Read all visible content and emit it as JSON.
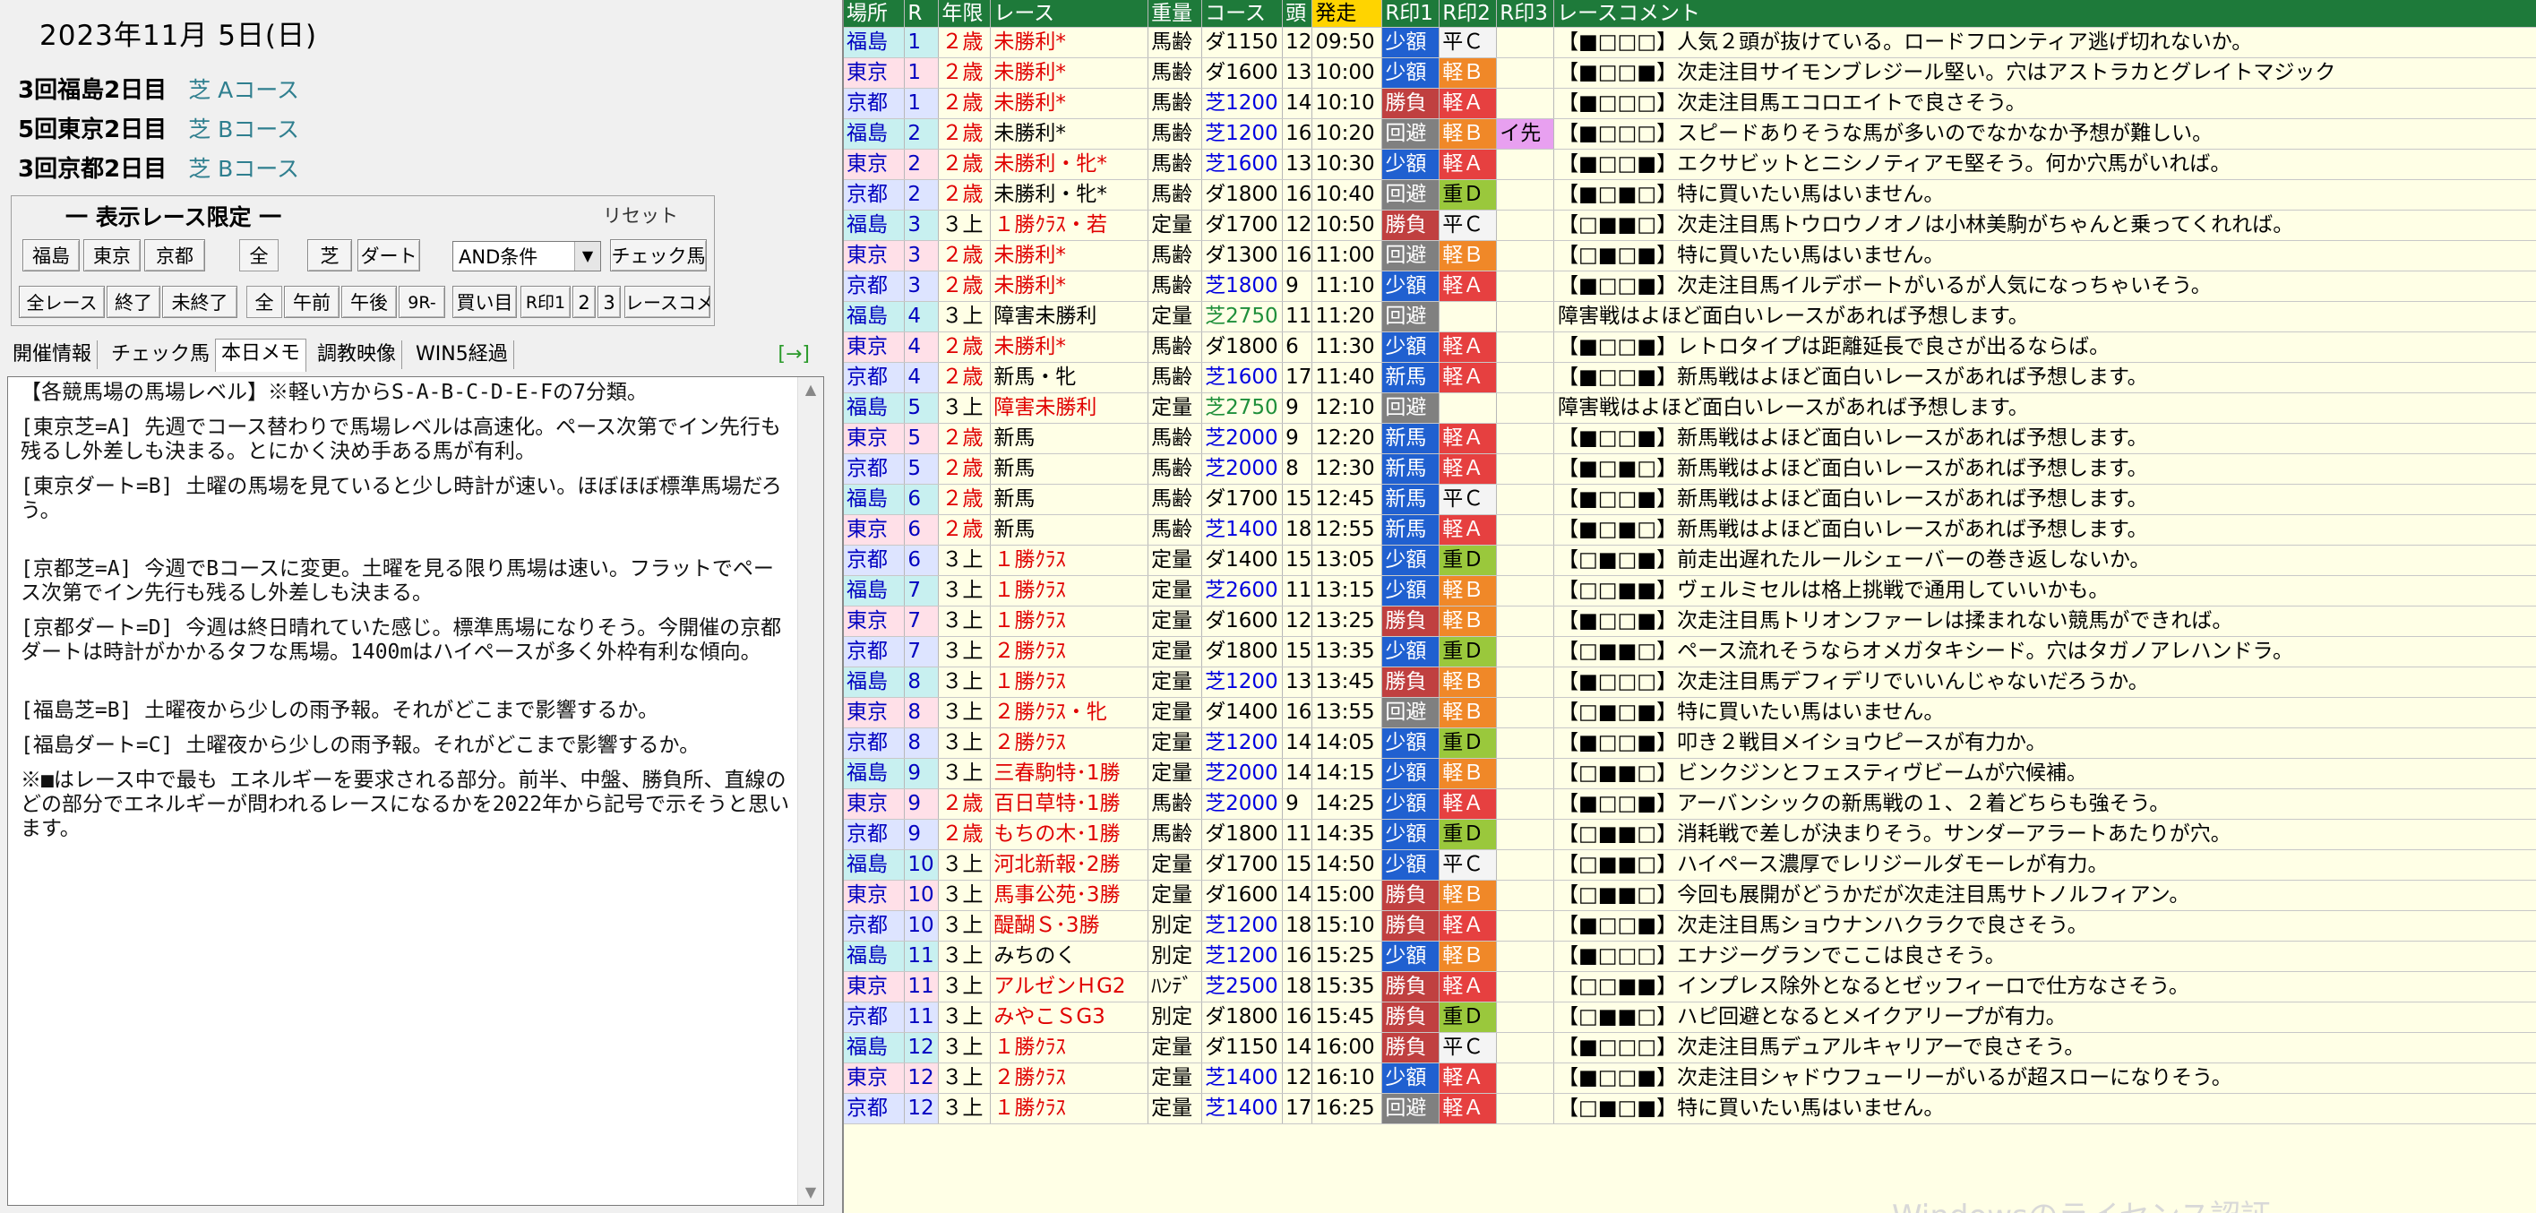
{
  "date": "2023年11月 5日(日)",
  "meetings": [
    {
      "name": "3回福島2日目",
      "course": "芝 Aコース"
    },
    {
      "name": "5回東京2日目",
      "course": "芝 Bコース"
    },
    {
      "name": "3回京都2日目",
      "course": "芝 Bコース"
    }
  ],
  "filter": {
    "title": "一 表示レース限定 一",
    "reset": "リセット",
    "row1": [
      "福島",
      "東京",
      "京都",
      "全",
      "芝",
      "ダート"
    ],
    "condition": "AND条件",
    "check_button": "チェック馬",
    "row2": [
      "全レース",
      "終了",
      "未終了",
      "全",
      "午前",
      "午後",
      "9R-",
      "買い目",
      "R印1",
      "2",
      "3",
      "レースコメ"
    ]
  },
  "tabs": [
    "開催情報",
    "チェック馬",
    "本日メモ",
    "調教映像",
    "WIN5経過"
  ],
  "tab_arrow": "[→]",
  "memo": [
    "【各競馬場の馬場レベル】※軽い方からS-A-B-C-D-E-Fの7分類。",
    "[東京芝=A] 先週でコース替わりで馬場レベルは高速化。ペース次第でイン先行も残るし外差しも決まる。とにかく決め手ある馬が有利。",
    "[東京ダート=B] 土曜の馬場を見ていると少し時計が速い。ほぼほぼ標準馬場だろう。",
    "[京都芝=A] 今週でBコースに変更。土曜を見る限り馬場は速い。フラットでペース次第でイン先行も残るし外差しも決まる。",
    "[京都ダート=D] 今週は終日晴れていた感じ。標準馬場になりそう。今開催の京都ダートは時計がかかるタフな馬場。1400mはハイペースが多く外枠有利な傾向。",
    "[福島芝=B] 土曜夜から少しの雨予報。それがどこまで影響するか。",
    "[福島ダート=C]  土曜夜から少しの雨予報。それがどこまで影響するか。",
    "※■はレース中で最も エネルギーを要求される部分。前半、中盤、勝負所、直線のどの部分でエネルギーが問われるレースになるかを2022年から記号で示そうと思います。"
  ],
  "table": {
    "headers": [
      "場所",
      "R",
      "年限",
      "レース",
      "重量",
      "コース",
      "頭",
      "発走",
      "R印1",
      "R印2",
      "R印3",
      "レースコメント"
    ],
    "rows": [
      [
        "福島",
        "1",
        "２歳",
        "未勝利*",
        "馬齢",
        "ダ1150",
        "12",
        "09:50",
        "少額",
        "平Ｃ",
        "",
        "【■□□□】人気２頭が抜けている。ロードフロンティア逃げ切れないか。"
      ],
      [
        "東京",
        "1",
        "２歳",
        "未勝利*",
        "馬齢",
        "ダ1600",
        "13",
        "10:00",
        "少額",
        "軽Ｂ",
        "",
        "【■□□■】次走注目サイモンブレジール堅い。穴はアストラカとグレイトマジック"
      ],
      [
        "京都",
        "1",
        "２歳",
        "未勝利*",
        "馬齢",
        "芝1200",
        "14",
        "10:10",
        "勝負",
        "軽Ａ",
        "",
        "【■□□□】次走注目馬エコロエイトで良さそう。"
      ],
      [
        "福島",
        "2",
        "２歳",
        "未勝利*",
        "馬齢",
        "芝1200",
        "16",
        "10:20",
        "回避",
        "軽Ｂ",
        "イ先",
        "【■□□□】スピードありそうな馬が多いのでなかなか予想が難しい。"
      ],
      [
        "東京",
        "2",
        "２歳",
        "未勝利・牝*",
        "馬齢",
        "芝1600",
        "13",
        "10:30",
        "少額",
        "軽Ａ",
        "",
        "【■□□■】エクサビットとニシノティアモ堅そう。何か穴馬がいれば。"
      ],
      [
        "京都",
        "2",
        "２歳",
        "未勝利・牝*",
        "馬齢",
        "ダ1800",
        "16",
        "10:40",
        "回避",
        "重Ｄ",
        "",
        "【■□■□】特に買いたい馬はいません。"
      ],
      [
        "福島",
        "3",
        "３上",
        "１勝ｸﾗｽ・若",
        "定量",
        "ダ1700",
        "12",
        "10:50",
        "勝負",
        "平Ｃ",
        "",
        "【□■■□】次走注目馬トウロウノオノは小林美駒がちゃんと乗ってくれれば。"
      ],
      [
        "東京",
        "3",
        "２歳",
        "未勝利*",
        "馬齢",
        "ダ1300",
        "16",
        "11:00",
        "回避",
        "軽Ｂ",
        "",
        "【□■□■】特に買いたい馬はいません。"
      ],
      [
        "京都",
        "3",
        "２歳",
        "未勝利*",
        "馬齢",
        "芝1800",
        "9",
        "11:10",
        "少額",
        "軽Ａ",
        "",
        "【■□□■】次走注目馬イルデボートがいるが人気になっちゃいそう。"
      ],
      [
        "福島",
        "4",
        "３上",
        "障害未勝利",
        "定量",
        "芝2750",
        "11",
        "11:20",
        "回避",
        "",
        "",
        "障害戦はよほど面白いレースがあれば予想します。"
      ],
      [
        "東京",
        "4",
        "２歳",
        "未勝利*",
        "馬齢",
        "ダ1800",
        "6",
        "11:30",
        "少額",
        "軽Ａ",
        "",
        "【■□□■】レトロタイプは距離延長で良さが出るならば。"
      ],
      [
        "京都",
        "4",
        "２歳",
        "新馬・牝",
        "馬齢",
        "芝1600",
        "17",
        "11:40",
        "新馬",
        "軽Ａ",
        "",
        "【■□□■】新馬戦はよほど面白いレースがあれば予想します。"
      ],
      [
        "福島",
        "5",
        "３上",
        "障害未勝利",
        "定量",
        "芝2750",
        "9",
        "12:10",
        "回避",
        "",
        "",
        "障害戦はよほど面白いレースがあれば予想します。"
      ],
      [
        "東京",
        "5",
        "２歳",
        "新馬",
        "馬齢",
        "芝2000",
        "9",
        "12:20",
        "新馬",
        "軽Ａ",
        "",
        "【■□□■】新馬戦はよほど面白いレースがあれば予想します。"
      ],
      [
        "京都",
        "5",
        "２歳",
        "新馬",
        "馬齢",
        "芝2000",
        "8",
        "12:30",
        "新馬",
        "軽Ａ",
        "",
        "【■□■□】新馬戦はよほど面白いレースがあれば予想します。"
      ],
      [
        "福島",
        "6",
        "２歳",
        "新馬",
        "馬齢",
        "ダ1700",
        "15",
        "12:45",
        "新馬",
        "平Ｃ",
        "",
        "【■□□■】新馬戦はよほど面白いレースがあれば予想します。"
      ],
      [
        "東京",
        "6",
        "２歳",
        "新馬",
        "馬齢",
        "芝1400",
        "18",
        "12:55",
        "新馬",
        "軽Ａ",
        "",
        "【■□■□】新馬戦はよほど面白いレースがあれば予想します。"
      ],
      [
        "京都",
        "6",
        "３上",
        "１勝ｸﾗｽ",
        "定量",
        "ダ1400",
        "15",
        "13:05",
        "少額",
        "重Ｄ",
        "",
        "【□■□■】前走出遅れたルールシェーバーの巻き返しないか。"
      ],
      [
        "福島",
        "7",
        "３上",
        "１勝ｸﾗｽ",
        "定量",
        "芝2600",
        "11",
        "13:15",
        "少額",
        "軽Ｂ",
        "",
        "【□□■■】ヴェルミセルは格上挑戦で通用していいかも。"
      ],
      [
        "東京",
        "7",
        "３上",
        "１勝ｸﾗｽ",
        "定量",
        "ダ1600",
        "12",
        "13:25",
        "勝負",
        "軽Ｂ",
        "",
        "【■□□■】次走注目馬トリオンファーレは揉まれない競馬ができれば。"
      ],
      [
        "京都",
        "7",
        "３上",
        "２勝ｸﾗｽ",
        "定量",
        "ダ1800",
        "15",
        "13:35",
        "少額",
        "重Ｄ",
        "",
        "【□■■□】ペース流れそうならオメガタキシード。穴はタガノアレハンドラ。"
      ],
      [
        "福島",
        "8",
        "３上",
        "１勝ｸﾗｽ",
        "定量",
        "芝1200",
        "13",
        "13:45",
        "勝負",
        "軽Ｂ",
        "",
        "【■□□□】次走注目馬デフィデリでいいんじゃないだろうか。"
      ],
      [
        "東京",
        "8",
        "３上",
        "２勝ｸﾗｽ・牝",
        "定量",
        "ダ1400",
        "16",
        "13:55",
        "回避",
        "軽Ｂ",
        "",
        "【□■□■】特に買いたい馬はいません。"
      ],
      [
        "京都",
        "8",
        "３上",
        "２勝ｸﾗｽ",
        "定量",
        "芝1200",
        "14",
        "14:05",
        "少額",
        "重Ｄ",
        "",
        "【■□□■】叩き２戦目メイショウピースが有力か。"
      ],
      [
        "福島",
        "9",
        "３上",
        "三春駒特･1勝",
        "定量",
        "芝2000",
        "14",
        "14:15",
        "少額",
        "軽Ｂ",
        "",
        "【□■■□】ビンクジンとフェスティヴビームが穴候補。"
      ],
      [
        "東京",
        "9",
        "２歳",
        "百日草特･1勝",
        "馬齢",
        "芝2000",
        "9",
        "14:25",
        "少額",
        "軽Ａ",
        "",
        "【■□□■】アーバンシックの新馬戦の１、２着どちらも強そう。"
      ],
      [
        "京都",
        "9",
        "２歳",
        "もちの木･1勝",
        "馬齢",
        "ダ1800",
        "11",
        "14:35",
        "少額",
        "重Ｄ",
        "",
        "【□■■□】消耗戦で差しが決まりそう。サンダーアラートあたりが穴。"
      ],
      [
        "福島",
        "10",
        "３上",
        "河北新報･2勝",
        "定量",
        "ダ1700",
        "15",
        "14:50",
        "少額",
        "平Ｃ",
        "",
        "【□■■□】ハイペース濃厚でレリジールダモーレが有力。"
      ],
      [
        "東京",
        "10",
        "３上",
        "馬事公苑･3勝",
        "定量",
        "ダ1600",
        "14",
        "15:00",
        "勝負",
        "軽Ｂ",
        "",
        "【□■■□】今回も展開がどうかだが次走注目馬サトノルフィアン。"
      ],
      [
        "京都",
        "10",
        "３上",
        "醍醐Ｓ･3勝",
        "別定",
        "芝1200",
        "18",
        "15:10",
        "勝負",
        "軽Ａ",
        "",
        "【■□□■】次走注目馬ショウナンハクラクで良さそう。"
      ],
      [
        "福島",
        "11",
        "３上",
        "みちのく",
        "別定",
        "芝1200",
        "16",
        "15:25",
        "少額",
        "軽Ｂ",
        "",
        "【■□□□】エナジーグランでここは良さそう。"
      ],
      [
        "東京",
        "11",
        "３上",
        "アルゼンＨG2",
        "ﾊﾝﾃﾞ",
        "芝2500",
        "18",
        "15:35",
        "勝負",
        "軽Ａ",
        "",
        "【□□■■】インプレス除外となるとゼッフィーロで仕方なさそう。"
      ],
      [
        "京都",
        "11",
        "３上",
        "みやこＳG3",
        "別定",
        "ダ1800",
        "16",
        "15:45",
        "勝負",
        "重Ｄ",
        "",
        "【□■■□】ハピ回避となるとメイクアリープが有力。"
      ],
      [
        "福島",
        "12",
        "３上",
        "１勝ｸﾗｽ",
        "定量",
        "ダ1150",
        "14",
        "16:00",
        "勝負",
        "平Ｃ",
        "",
        "【■□□□】次走注目馬デュアルキャリアーで良さそう。"
      ],
      [
        "東京",
        "12",
        "３上",
        "２勝ｸﾗｽ",
        "定量",
        "芝1400",
        "12",
        "16:10",
        "少額",
        "軽Ａ",
        "",
        "【■□□■】次走注目シャドウフューリーがいるが超スローになりそう。"
      ],
      [
        "京都",
        "12",
        "３上",
        "１勝ｸﾗｽ",
        "定量",
        "芝1400",
        "17",
        "16:25",
        "回避",
        "軽Ａ",
        "",
        "【□■□■】特に買いたい馬はいません。"
      ]
    ]
  },
  "watermark": "Windowsのライセンス認証"
}
